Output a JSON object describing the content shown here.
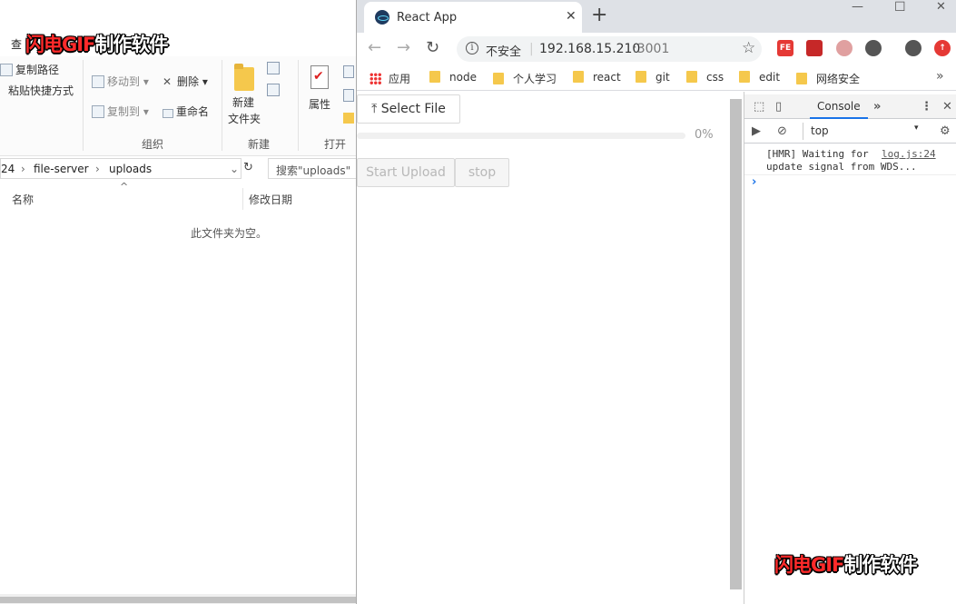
{
  "explorer": {
    "ribbon_tab_partial": "查",
    "ribbon": {
      "copy_path": "复制路径",
      "paste_shortcut": "粘贴快捷方式",
      "move_to": "移动到",
      "copy_to": "复制到",
      "delete": "删除",
      "rename": "重命名",
      "new_folder_line1": "新建",
      "new_folder_line2": "文件夹",
      "properties": "属性",
      "group_organize": "组织",
      "group_new": "新建",
      "group_open": "打开"
    },
    "address": {
      "segments": [
        "24",
        "file-server",
        "uploads"
      ],
      "search_placeholder": "搜索\"uploads\""
    },
    "columns": {
      "name": "名称",
      "modified": "修改日期"
    },
    "empty_message": "此文件夹为空。"
  },
  "watermark": {
    "red": "闪电GIF",
    "white": "制作软件"
  },
  "browser": {
    "tab_title": "React App",
    "security_label": "不安全",
    "url_host": "192.168.15.210",
    "url_port": ":3001",
    "bookmarks": [
      "应用",
      "node",
      "个人学习",
      "react",
      "git",
      "css",
      "edit",
      "网络安全"
    ],
    "extensions": [
      "FE"
    ]
  },
  "app": {
    "select_file_label": "Select File",
    "progress": 0,
    "progress_text": "0%",
    "start_upload_label": "Start Upload",
    "stop_label": "stop"
  },
  "devtools": {
    "console_tab": "Console",
    "context": "top",
    "log_line1": "[HMR] Waiting for",
    "log_line2": "update signal from WDS...",
    "log_source": "log.js:24"
  },
  "colors": {
    "progress_fill": "#1890ff",
    "watermark_red": "#ff2a2a"
  }
}
